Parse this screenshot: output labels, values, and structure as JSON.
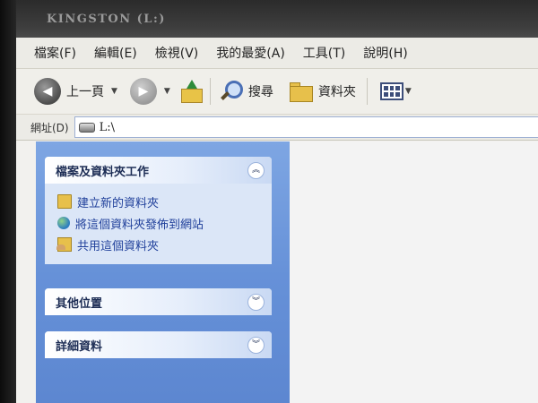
{
  "window": {
    "title": "KINGSTON (L:)"
  },
  "menubar": {
    "items": [
      {
        "label": "檔案(F)"
      },
      {
        "label": "編輯(E)"
      },
      {
        "label": "檢視(V)"
      },
      {
        "label": "我的最愛(A)"
      },
      {
        "label": "工具(T)"
      },
      {
        "label": "說明(H)"
      }
    ]
  },
  "toolbar": {
    "back_label": "上一頁",
    "search_label": "搜尋",
    "folders_label": "資料夾"
  },
  "address": {
    "label": "網址(D)",
    "value": "L:\\"
  },
  "taskpane": {
    "file_tasks": {
      "title": "檔案及資料夾工作",
      "items": [
        {
          "label": "建立新的資料夾",
          "icon": "new-folder-icon"
        },
        {
          "label": "將這個資料夾發佈到網站",
          "icon": "globe-icon"
        },
        {
          "label": "共用這個資料夾",
          "icon": "share-folder-icon"
        }
      ],
      "toggle": "︽"
    },
    "other_places": {
      "title": "其他位置",
      "toggle": "︾"
    },
    "details": {
      "title": "詳細資料",
      "toggle": "︾"
    }
  },
  "colors": {
    "taskpane_blue": "#6691d8",
    "panel_bg": "#dbe6f7",
    "link": "#1f3f9a"
  }
}
